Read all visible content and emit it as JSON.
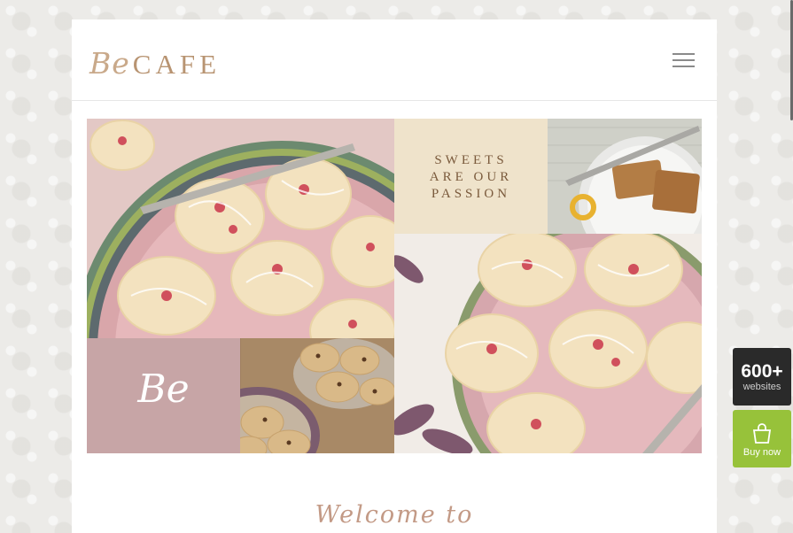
{
  "header": {
    "logo_be": "Be",
    "logo_cafe": "CAFE"
  },
  "banner": {
    "tagline_lines": [
      "SWEETS",
      "ARE OUR",
      "PASSION"
    ],
    "be_word": "Be"
  },
  "welcome": {
    "title": "Welcome to"
  },
  "side_widgets": {
    "sites_count": "600+",
    "sites_label": "websites",
    "buy_label": "Buy now"
  },
  "colors": {
    "logo": "#b89472",
    "buy_green": "#97c23a",
    "dark_box": "#2a2a2a",
    "welcome": "#c39a86"
  }
}
